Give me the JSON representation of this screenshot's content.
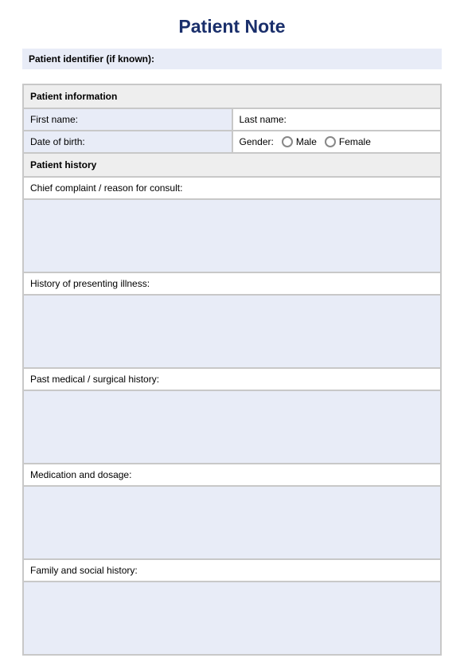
{
  "title": "Patient Note",
  "identifier_label": "Patient identifier (if known):",
  "section_info": "Patient information",
  "first_name_label": "First name:",
  "last_name_label": "Last name:",
  "dob_label": "Date of birth:",
  "gender_label": "Gender:",
  "gender_male": "Male",
  "gender_female": "Female",
  "section_history": "Patient history",
  "chief_complaint_label": "Chief complaint / reason for consult:",
  "hpi_label": "History of presenting illness:",
  "pmh_label": "Past medical / surgical history:",
  "meds_label": "Medication and dosage:",
  "family_label": "Family and social history:"
}
